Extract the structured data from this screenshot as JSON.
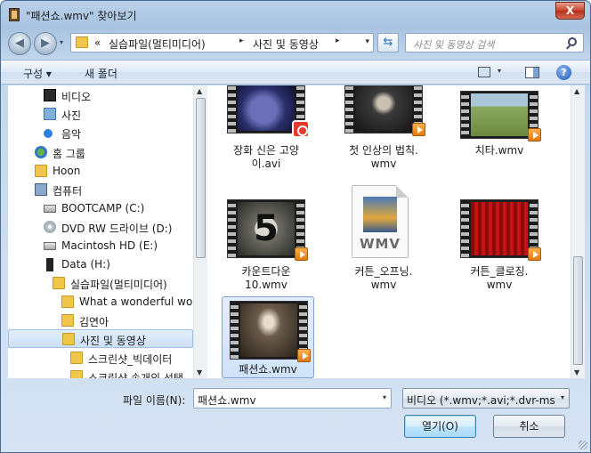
{
  "window": {
    "title": "\"패션쇼.wmv\" 찾아보기",
    "close_label": "X"
  },
  "address": {
    "prefix": "«",
    "crumbs": [
      "실습파일(멀티미디어)",
      "사진 및 동영상"
    ],
    "separator": "▸",
    "dropdown": "▾"
  },
  "search": {
    "placeholder": "사진 및 동영상 검색"
  },
  "toolbar": {
    "organize": "구성 ▾",
    "new_folder": "새 폴더",
    "view_dropdown": "▾",
    "help": "?"
  },
  "nav": {
    "items": [
      {
        "label": "비디오",
        "icon": "video-icon"
      },
      {
        "label": "사진",
        "icon": "photo-icon"
      },
      {
        "label": "음악",
        "icon": "music-icon"
      },
      {
        "label": "홈 그룹",
        "icon": "homegroup-icon"
      },
      {
        "label": "Hoon",
        "icon": "user-folder-icon"
      },
      {
        "label": "컴퓨터",
        "icon": "computer-icon"
      },
      {
        "label": "BOOTCAMP (C:)",
        "icon": "drive-icon"
      },
      {
        "label": "DVD RW 드라이브 (D:)",
        "icon": "dvd-icon"
      },
      {
        "label": "Macintosh HD (E:)",
        "icon": "drive-icon"
      },
      {
        "label": "Data (H:)",
        "icon": "device-icon"
      },
      {
        "label": "실습파일(멀티미디어)",
        "icon": "folder-icon"
      },
      {
        "label": "What a wonderful world",
        "icon": "folder-icon"
      },
      {
        "label": "김연아",
        "icon": "folder-icon"
      },
      {
        "label": "사진 및 동영상",
        "icon": "folder-icon"
      },
      {
        "label": "스크린샷_빅데이터",
        "icon": "folder-icon"
      },
      {
        "label": "스크린샷 속개의 선택",
        "icon": "folder-icon"
      }
    ]
  },
  "files": [
    {
      "name_line1": "장화 신은 고양",
      "name_line2": "이.avi",
      "badge": "app"
    },
    {
      "name_line1": "첫 인상의 법칙.",
      "name_line2": "wmv",
      "badge": "play"
    },
    {
      "name_line1": "치타.wmv",
      "name_line2": "",
      "badge": "play"
    },
    {
      "name_line1": "카운트다운",
      "name_line2": "10.wmv",
      "badge": "play"
    },
    {
      "name_line1": "커튼_오프닝.",
      "name_line2": "wmv",
      "badge": "none",
      "doc_ext": "WMV"
    },
    {
      "name_line1": "커튼_클로징.",
      "name_line2": "wmv",
      "badge": "play"
    },
    {
      "name_line1": "패션쇼.wmv",
      "name_line2": "",
      "badge": "play"
    }
  ],
  "bottom": {
    "filename_label": "파일 이름(N):",
    "filename_value": "패션쇼.wmv",
    "filetype_value": "비디오 (*.wmv;*.avi;*.dvr-ms;*.",
    "open_button": "열기(O)",
    "cancel_button": "취소",
    "dropdown": "▾"
  },
  "scroll": {
    "up": "▲",
    "down": "▼"
  },
  "colors": {
    "accent": "#3c7fb1",
    "selection": "#cde0f7"
  }
}
